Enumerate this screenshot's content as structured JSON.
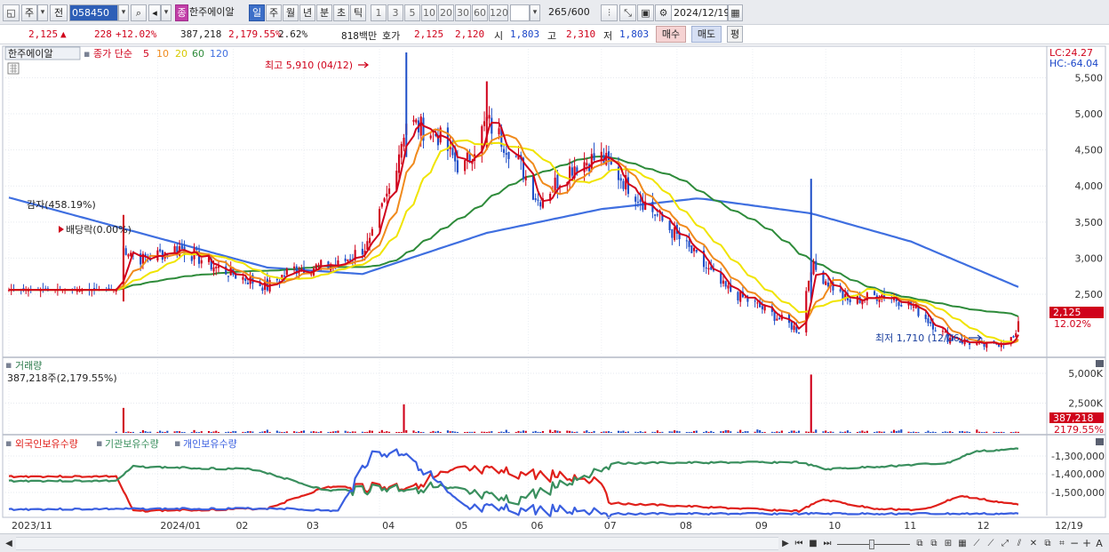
{
  "toolbar": {
    "market": "주",
    "prev": "전",
    "code": "058450",
    "badge": "종",
    "name": "한주에이알",
    "periods": [
      "일",
      "주",
      "월",
      "년",
      "분",
      "초",
      "틱"
    ],
    "active_period": "일",
    "counts": [
      "1",
      "3",
      "5",
      "10",
      "20",
      "30",
      "60",
      "120"
    ],
    "range": "265",
    "range_total": "/600",
    "date": "2024/12/19"
  },
  "quote": {
    "price": "2,125",
    "change": "228",
    "change_pct": "+12.02%",
    "volume": "387,218",
    "volume_pct": "2,179.55%",
    "turnover_pct": "2.62%",
    "amount": "818백만",
    "bid_label": "호가",
    "ask": "2,125",
    "bid": "2,120",
    "open_label": "시",
    "open": "1,803",
    "high_label": "고",
    "high": "2,310",
    "low_label": "저",
    "low": "1,803",
    "buy_btn": "매수",
    "sell_btn": "매도",
    "eval_btn": "평"
  },
  "colors": {
    "up": "#d0021b",
    "down": "#1f4fc8",
    "ma5": "#d0021b",
    "ma10": "#f08a1c",
    "ma20": "#f0e400",
    "ma60": "#2e8b3a",
    "ma120": "#3f6fe0",
    "foreign": "#e0201b",
    "institution": "#3a8f5e",
    "individual": "#3a5fe0"
  },
  "chart_data": [
    {
      "type": "candlestick",
      "title": "한주에이알",
      "legend_prefix": "종가 단순",
      "ma_periods": [
        "5",
        "10",
        "20",
        "60",
        "120"
      ],
      "x_ticks": [
        "2023/11",
        "2024/01",
        "02",
        "03",
        "04",
        "05",
        "06",
        "07",
        "08",
        "09",
        "10",
        "11",
        "12",
        "12/19"
      ],
      "y_ticks": [
        "5,500",
        "5,000",
        "4,500",
        "4,000",
        "3,500",
        "3,000",
        "2,500"
      ],
      "ylim": [
        1650,
        5900
      ],
      "lc_label": "LC:24.27",
      "hc_label": "HC:-64.04",
      "current_price": "2,125",
      "current_pct": "12.02%",
      "annotations": {
        "high": "최고 5,910 (04/12)",
        "low": "최저 1,710 (12/06)",
        "capital_reduction": "감자(458.19%)",
        "dividend": "배당락(0.00%)"
      },
      "approx_close": [
        [
          "2023-11-01",
          2560
        ],
        [
          "2023-12-15",
          2560
        ],
        [
          "2023-12-18",
          3150
        ],
        [
          "2023-12-26",
          2980
        ],
        [
          "2024-01-10",
          3150
        ],
        [
          "2024-01-25",
          2870
        ],
        [
          "2024-02-15",
          2600
        ],
        [
          "2024-02-25",
          2850
        ],
        [
          "2024-03-15",
          2900
        ],
        [
          "2024-03-28",
          3200
        ],
        [
          "2024-04-05",
          3950
        ],
        [
          "2024-04-12",
          4900
        ],
        [
          "2024-04-25",
          4700
        ],
        [
          "2024-05-05",
          4200
        ],
        [
          "2024-05-15",
          4900
        ],
        [
          "2024-05-27",
          4400
        ],
        [
          "2024-06-05",
          3800
        ],
        [
          "2024-06-20",
          4300
        ],
        [
          "2024-07-01",
          4400
        ],
        [
          "2024-07-15",
          3900
        ],
        [
          "2024-08-01",
          3300
        ],
        [
          "2024-08-20",
          2600
        ],
        [
          "2024-09-05",
          2300
        ],
        [
          "2024-09-20",
          2000
        ],
        [
          "2024-09-25",
          2900
        ],
        [
          "2024-10-10",
          2400
        ],
        [
          "2024-10-25",
          2500
        ],
        [
          "2024-11-05",
          2350
        ],
        [
          "2024-11-20",
          1900
        ],
        [
          "2024-12-06",
          1780
        ],
        [
          "2024-12-18",
          1897
        ],
        [
          "2024-12-19",
          2125
        ]
      ],
      "ma120_approx": [
        [
          "2023-11-01",
          3840
        ],
        [
          "2024-02-15",
          2870
        ],
        [
          "2024-03-25",
          2780
        ],
        [
          "2024-05-15",
          3350
        ],
        [
          "2024-07-01",
          3680
        ],
        [
          "2024-08-10",
          3830
        ],
        [
          "2024-09-25",
          3620
        ],
        [
          "2024-11-05",
          3230
        ],
        [
          "2024-12-19",
          2600
        ]
      ]
    },
    {
      "type": "bar",
      "title": "거래량",
      "subtitle": "387,218주(2,179.55%)",
      "y_ticks": [
        "5,000K",
        "2,500K"
      ],
      "current_value": "387,218",
      "current_pct": "2179.55%",
      "notable_spikes": [
        [
          "2023-12-18",
          2100000
        ],
        [
          "2024-04-11",
          2400000
        ],
        [
          "2024-09-25",
          4900000
        ]
      ]
    },
    {
      "type": "line",
      "series": [
        {
          "name": "외국인보유수량"
        },
        {
          "name": "기관보유수량"
        },
        {
          "name": "개인보유수량"
        }
      ],
      "y_ticks": [
        "-1,300,000",
        "-1,400,000",
        "-1,500,000"
      ]
    }
  ],
  "scrollbar": {
    "prev": "◀",
    "next": "▶",
    "stop": "■"
  }
}
